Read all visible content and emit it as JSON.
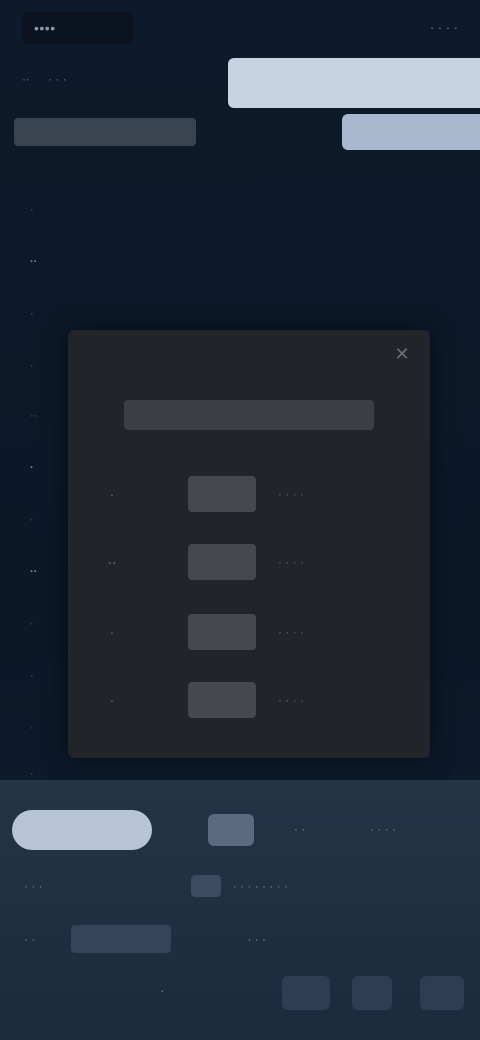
{
  "header": {
    "logo": "••••",
    "top_right": "· · · ·",
    "subnav": [
      "··",
      "· · ·"
    ],
    "hero_title": "",
    "hero_sub": "",
    "hero_left": ""
  },
  "axis": {
    "labels": [
      "·",
      "··",
      "·",
      "·",
      "··",
      "·",
      "·",
      "··",
      "·",
      "·",
      "·",
      "·"
    ]
  },
  "modal": {
    "close_glyph": "✕",
    "title": "",
    "rows": [
      {
        "rank": "·",
        "score": "",
        "meta": "· · · ·"
      },
      {
        "rank": "··",
        "score": "",
        "meta": "· · · ·"
      },
      {
        "rank": "·",
        "score": "",
        "meta": "· · · ·"
      },
      {
        "rank": "·",
        "score": "",
        "meta": "· · · ·"
      }
    ]
  },
  "bottom": {
    "tabs": {
      "primary": "",
      "second": "",
      "third": "· ·",
      "fourth": "· · · ·"
    },
    "info": {
      "left": "· · ·",
      "pill": "",
      "right": "· · · · · · · ·"
    },
    "field": {
      "label": "· ·",
      "value": "",
      "right": "· · ·"
    },
    "actions": {
      "left": "·",
      "b1": "",
      "b2": "",
      "b3": ""
    }
  },
  "colors": {
    "background": "#0c1a2b",
    "modal": "#212428",
    "accent": "#b6c4d6"
  }
}
